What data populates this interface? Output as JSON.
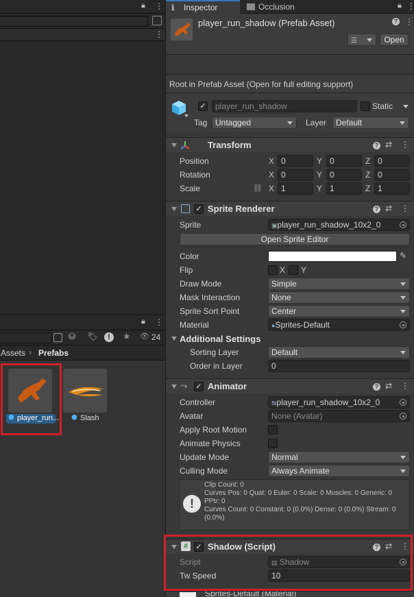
{
  "inspector": {
    "tabs": [
      {
        "label": "Inspector"
      },
      {
        "label": "Occlusion"
      }
    ],
    "asset_title": "player_run_shadow (Prefab Asset)",
    "open_label": "Open",
    "root_note": "Root in Prefab Asset (Open for full editing support)",
    "object_name": "player_run_shadow",
    "static_label": "Static",
    "tag_label": "Tag",
    "tag_value": "Untagged",
    "layer_label": "Layer",
    "layer_value": "Default"
  },
  "transform": {
    "title": "Transform",
    "position_label": "Position",
    "rotation_label": "Rotation",
    "scale_label": "Scale",
    "axes": [
      "X",
      "Y",
      "Z"
    ],
    "position": [
      "0",
      "0",
      "0"
    ],
    "rotation": [
      "0",
      "0",
      "0"
    ],
    "scale": [
      "1",
      "1",
      "1"
    ]
  },
  "sprite_renderer": {
    "title": "Sprite Renderer",
    "sprite_label": "Sprite",
    "sprite_value": "player_run_shadow_10x2_0",
    "open_editor": "Open Sprite Editor",
    "color_label": "Color",
    "color_value": "#ffffff",
    "flip_label": "Flip",
    "flip_x": "X",
    "flip_y": "Y",
    "draw_mode_label": "Draw Mode",
    "draw_mode": "Simple",
    "mask_label": "Mask Interaction",
    "mask": "None",
    "sort_point_label": "Sprite Sort Point",
    "sort_point": "Center",
    "material_label": "Material",
    "material": "Sprites-Default",
    "additional_label": "Additional Settings",
    "sorting_layer_label": "Sorting Layer",
    "sorting_layer": "Default",
    "order_label": "Order in Layer",
    "order": "0"
  },
  "animator": {
    "title": "Animator",
    "controller_label": "Controller",
    "controller": "player_run_shadow_10x2_0",
    "avatar_label": "Avatar",
    "avatar": "None (Avatar)",
    "root_motion_label": "Apply Root Motion",
    "physics_label": "Animate Physics",
    "update_label": "Update Mode",
    "update": "Normal",
    "culling_label": "Culling Mode",
    "culling": "Always Animate",
    "info_lines": [
      "Clip Count: 0",
      "Curves Pos: 0 Quat: 0 Euler: 0 Scale: 0 Muscles: 0 Generic: 0",
      "PPtr: 0",
      "Curves Count: 0 Constant: 0 (0.0%) Dense: 0 (0.0%) Stream: 0",
      "(0.0%)"
    ]
  },
  "shadow": {
    "title": "Shadow (Script)",
    "script_label": "Script",
    "script": "Shadow",
    "speed_label": "Tw Speed",
    "speed": "10"
  },
  "next_component": "Sprites-Default (Material)",
  "project": {
    "breadcrumb_root": "Assets",
    "breadcrumb_current": "Prefabs",
    "hidden_count": "24",
    "assets": [
      {
        "label": "player_run..."
      },
      {
        "label": "Slash"
      }
    ]
  },
  "colors": {
    "highlight": "#d0202a",
    "selection": "#2c5d87",
    "sprite_orange": "#d2691e"
  }
}
